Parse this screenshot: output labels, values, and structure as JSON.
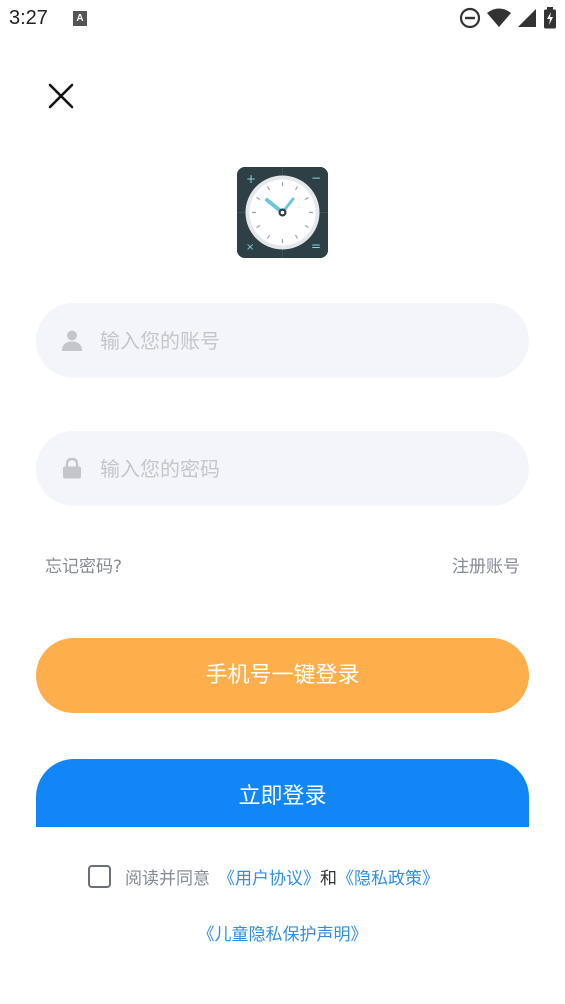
{
  "status_bar": {
    "time": "3:27",
    "notification_letter": "A",
    "icons": [
      "dnd-icon",
      "wifi-icon",
      "signal-icon",
      "battery-charging-icon"
    ]
  },
  "close_icon": "close-icon",
  "logo_icon": "clock-calculator-logo",
  "login_form": {
    "account_placeholder": "输入您的账号",
    "account_value": "",
    "account_icon": "user-icon",
    "password_placeholder": "输入您的密码",
    "password_value": "",
    "password_icon": "lock-icon",
    "forgot_password": "忘记密码?",
    "register": "注册账号"
  },
  "buttons": {
    "phone_login": "手机号一键登录",
    "login_now": "立即登录"
  },
  "agreement": {
    "prefix": "阅读并同意",
    "user_agreement": "《用户协议》",
    "and": "和",
    "privacy_policy": "《隐私政策》",
    "children_privacy": "《儿童隐私保护声明》",
    "checked": false
  },
  "colors": {
    "phone_button": "#ffae4c",
    "login_button": "#1187f7",
    "field_bg": "#f3f5fa",
    "link": "#2f8fe8",
    "logo_bg": "#2f3f46"
  }
}
